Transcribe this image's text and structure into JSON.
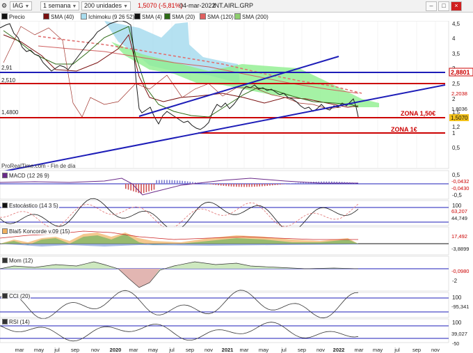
{
  "toolbar": {
    "symbol": "IAG",
    "timeframe": "1 semana",
    "units": "200 unidades",
    "price_change": "1,5070 (-5,81%)",
    "date": "04-mar-2022",
    "market": "INT.AIRL.GRP"
  },
  "legend": {
    "precio": "Precio",
    "sma40": "SMA (40)",
    "ichimoku": "Ichimoku (9 26 52)",
    "sma4": "SMA (4)",
    "sma20": "SMA (20)",
    "sma120": "SMA (120)",
    "sma200": "SMA (200)"
  },
  "main": {
    "y_ticks": [
      "4,5",
      "4",
      "3,5",
      "3",
      "2,5",
      "2",
      "1,5",
      "1,2",
      "1",
      "0,5"
    ],
    "level_labels_left": [
      "2,91",
      "2,510",
      "1,4800"
    ],
    "price_badges": [
      "2,8801",
      "2,2038",
      "1,8036",
      "1,5070"
    ],
    "zone_labels": [
      "ZONA 1,50€",
      "ZONA 1€"
    ],
    "source": "ProRealTime.com - Fin de día"
  },
  "indicators": {
    "macd": {
      "label": "MACD (12 26 9)",
      "ticks": [
        "0,5",
        "-0,5"
      ],
      "values": [
        "-0,0432",
        "-0,0430"
      ]
    },
    "stoch": {
      "label": "Estocástico (14 3 5)",
      "ticks": [
        "100"
      ],
      "values": [
        "63,207",
        "44,749"
      ]
    },
    "blai5": {
      "label": "Blai5 Koncorde v.09 (15)",
      "values": [
        "17,492",
        "-3,8899"
      ]
    },
    "mom": {
      "label": "Mom (12)",
      "ticks": [
        "-2"
      ],
      "values": [
        "-0,0980"
      ]
    },
    "cci": {
      "label": "CCI (20)",
      "ticks": [
        "100"
      ],
      "values": [
        "-95,341"
      ]
    },
    "rsi": {
      "label": "RSI (14)",
      "ticks": [
        "100",
        "-50"
      ],
      "values": [
        "39,027"
      ]
    }
  },
  "x_axis": [
    "mar",
    "may",
    "jul",
    "sep",
    "nov",
    "2020",
    "mar",
    "may",
    "jul",
    "sep",
    "nov",
    "2021",
    "mar",
    "may",
    "jul",
    "sep",
    "nov",
    "2022",
    "mar",
    "may",
    "jul",
    "sep",
    "nov"
  ],
  "colors": {
    "price": "#1a1a1a",
    "sma40": "#7a1010",
    "sma20": "#2e6b16",
    "support": "#cc0000",
    "trend": "#1d1db8",
    "cloud": "#8fef8f",
    "cloud_alt": "#a8dcee"
  }
}
